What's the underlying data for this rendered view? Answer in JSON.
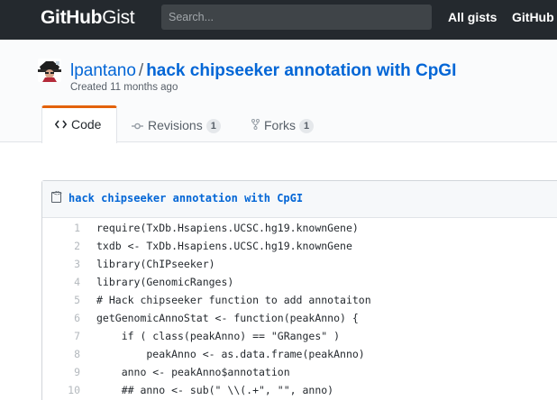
{
  "header": {
    "logo_bold": "GitHub",
    "logo_light": "Gist",
    "search_placeholder": "Search...",
    "nav": [
      "All gists",
      "GitHub"
    ]
  },
  "gist": {
    "owner": "lpantano",
    "separator": "/",
    "name": "hack chipseeker annotation with CpGI",
    "created": "Created 11 months ago"
  },
  "tabs": [
    {
      "label": "Code",
      "icon": "code-icon",
      "count": null
    },
    {
      "label": "Revisions",
      "icon": "commit-icon",
      "count": "1"
    },
    {
      "label": "Forks",
      "icon": "fork-icon",
      "count": "1"
    }
  ],
  "file": {
    "name": "hack chipseeker annotation with CpGI",
    "lines": [
      {
        "n": "1",
        "text": "require(TxDb.Hsapiens.UCSC.hg19.knownGene)"
      },
      {
        "n": "2",
        "text": "txdb <- TxDb.Hsapiens.UCSC.hg19.knownGene"
      },
      {
        "n": "3",
        "text": "library(ChIPseeker)"
      },
      {
        "n": "4",
        "text": "library(GenomicRanges)"
      },
      {
        "n": "5",
        "text": "# Hack chipseeker function to add annotaiton"
      },
      {
        "n": "6",
        "text": "getGenomicAnnoStat <- function(peakAnno) {"
      },
      {
        "n": "7",
        "text": "    if ( class(peakAnno) == \"GRanges\" )"
      },
      {
        "n": "8",
        "text": "        peakAnno <- as.data.frame(peakAnno)"
      },
      {
        "n": "9",
        "text": "    anno <- peakAnno$annotation"
      },
      {
        "n": "10",
        "text": "    ## anno <- sub(\" \\\\(.+\", \"\", anno)"
      }
    ]
  },
  "colors": {
    "header_bg": "#24292e",
    "link": "#0366d6",
    "tab_accent": "#e36209"
  }
}
